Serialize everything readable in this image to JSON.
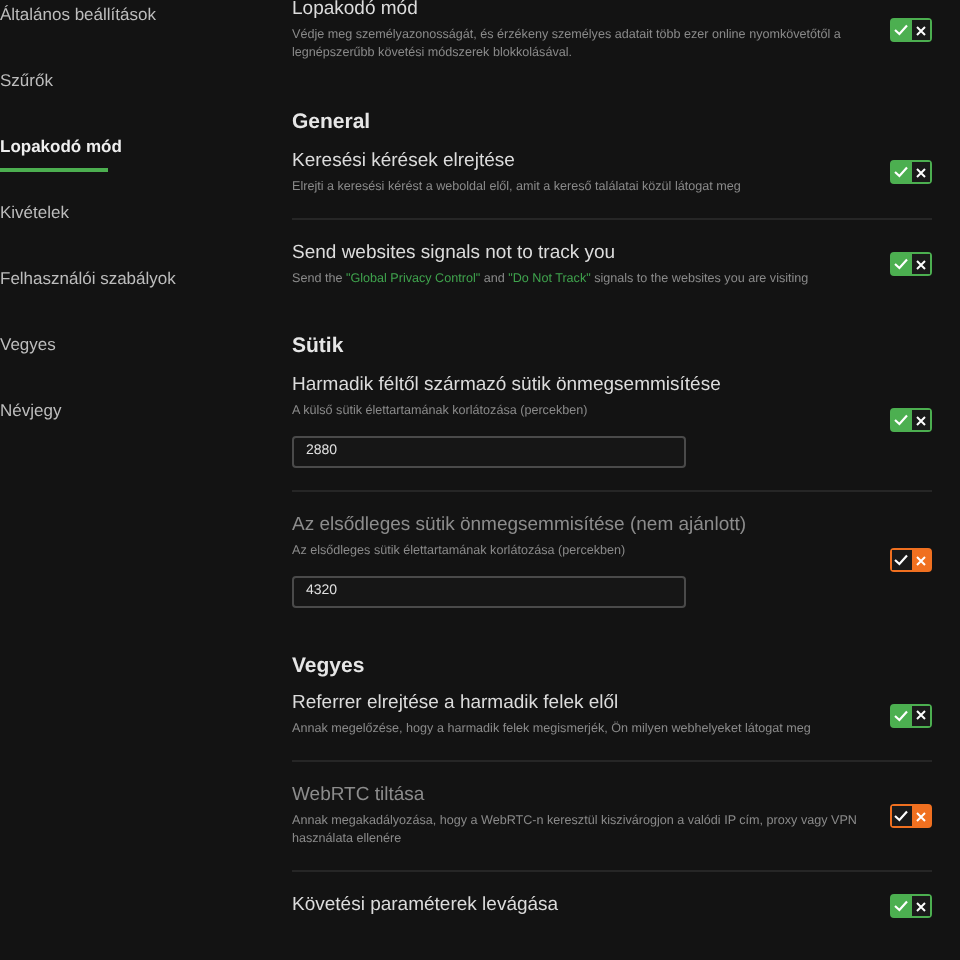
{
  "sidebar": {
    "items": [
      {
        "label": "Általános beállítások",
        "selected": false
      },
      {
        "label": "Szűrők",
        "selected": false
      },
      {
        "label": "Lopakodó mód",
        "selected": true
      },
      {
        "label": "Kivételek",
        "selected": false
      },
      {
        "label": "Felhasználói szabályok",
        "selected": false
      },
      {
        "label": "Vegyes",
        "selected": false
      },
      {
        "label": "Névjegy",
        "selected": false
      }
    ]
  },
  "sections": [
    {
      "rows": [
        {
          "title": "Lopakodó mód",
          "description": "Védje meg személyazonosságát, és érzékeny személyes adatait több ezer online nyomkövetőtől a legnépszerűbb követési módszerek blokkolásával.",
          "on": true
        }
      ]
    },
    {
      "heading": "General",
      "rows": [
        {
          "title": "Keresési kérések elrejtése",
          "description": "Elrejti a keresési kérést a weboldal elől, amit a kereső találatai közül látogat meg",
          "on": true
        },
        {
          "title": "Send websites signals not to track you",
          "description_parts": [
            {
              "text": "Send the ",
              "kind": "plain"
            },
            {
              "text": "\"Global Privacy Control\"",
              "kind": "quoted"
            },
            {
              "text": " and ",
              "kind": "plain"
            },
            {
              "text": "\"Do Not Track\"",
              "kind": "quoted"
            },
            {
              "text": " signals to the websites you are visiting",
              "kind": "plain"
            }
          ],
          "on": true
        }
      ]
    },
    {
      "heading": "Sütik",
      "rows": [
        {
          "title": "Harmadik féltől származó sütik önmegsemmisítése",
          "description": "A külső sütik élettartamának korlátozása (percekben)",
          "input_value": "2880",
          "on": true
        },
        {
          "title": "Az elsődleges sütik önmegsemmisítése (nem ajánlott)",
          "description": "Az elsődleges sütik élettartamának korlátozása (percekben)",
          "input_value": "4320",
          "on": false
        }
      ]
    },
    {
      "heading": "Vegyes",
      "rows": [
        {
          "title": "Referrer elrejtése a harmadik felek elől",
          "description": "Annak megelőzése, hogy a harmadik felek megismerjék, Ön milyen webhelyeket látogat meg",
          "on": true
        },
        {
          "title": "WebRTC tiltása",
          "description": "Annak megakadályozása, hogy a WebRTC-n keresztül kiszivárogjon a valódi IP cím, proxy vagy VPN használata ellenére",
          "on": false
        },
        {
          "title": "Követési paraméterek levágása",
          "on": true
        }
      ]
    }
  ]
}
